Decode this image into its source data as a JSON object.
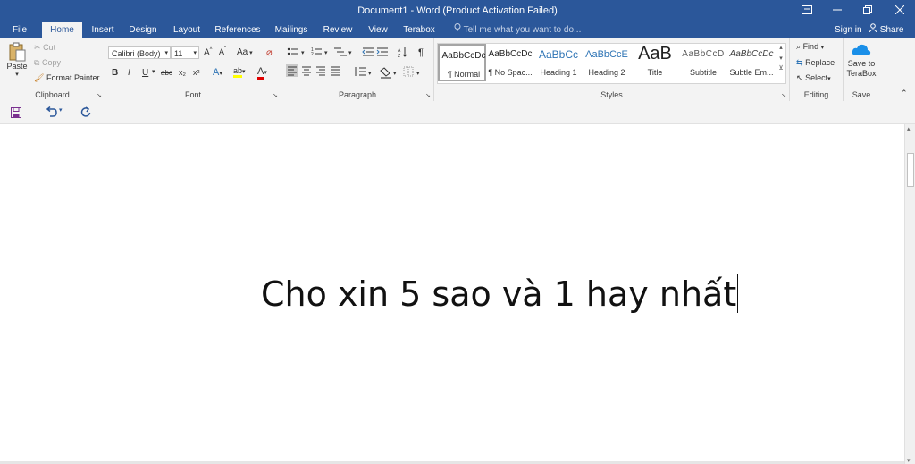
{
  "window": {
    "title": "Document1 - Word (Product Activation Failed)"
  },
  "tabs": [
    "File",
    "Home",
    "Insert",
    "Design",
    "Layout",
    "References",
    "Mailings",
    "Review",
    "View",
    "Terabox"
  ],
  "tell_me": "Tell me what you want to do...",
  "account": {
    "signin": "Sign in",
    "share": "Share"
  },
  "clipboard": {
    "paste": "Paste",
    "cut": "Cut",
    "copy": "Copy",
    "format_painter": "Format Painter",
    "label": "Clipboard"
  },
  "font": {
    "name": "Calibri (Body)",
    "size": "11",
    "case": "Aa",
    "bold": "B",
    "italic": "I",
    "underline": "U",
    "strike": "abc",
    "sub": "x₂",
    "sup": "x²",
    "label": "Font"
  },
  "paragraph": {
    "label": "Paragraph"
  },
  "styles": {
    "label": "Styles",
    "items": [
      {
        "preview": "AaBbCcDc",
        "name": "¶ Normal"
      },
      {
        "preview": "AaBbCcDc",
        "name": "¶ No Spac..."
      },
      {
        "preview": "AaBbCc",
        "name": "Heading 1"
      },
      {
        "preview": "AaBbCcE",
        "name": "Heading 2"
      },
      {
        "preview": "AaB",
        "name": "Title"
      },
      {
        "preview": "AaBbCcD",
        "name": "Subtitle"
      },
      {
        "preview": "AaBbCcDc",
        "name": "Subtle Em..."
      }
    ]
  },
  "editing": {
    "find": "Find",
    "replace": "Replace",
    "select": "Select",
    "label": "Editing"
  },
  "save": {
    "save_to": "Save to TeraBox",
    "label": "Save"
  },
  "document": {
    "text": "Cho xin 5 sao và 1 hay nhất"
  },
  "colors": {
    "accent": "#2b579a",
    "ribbon": "#f3f3f3"
  }
}
